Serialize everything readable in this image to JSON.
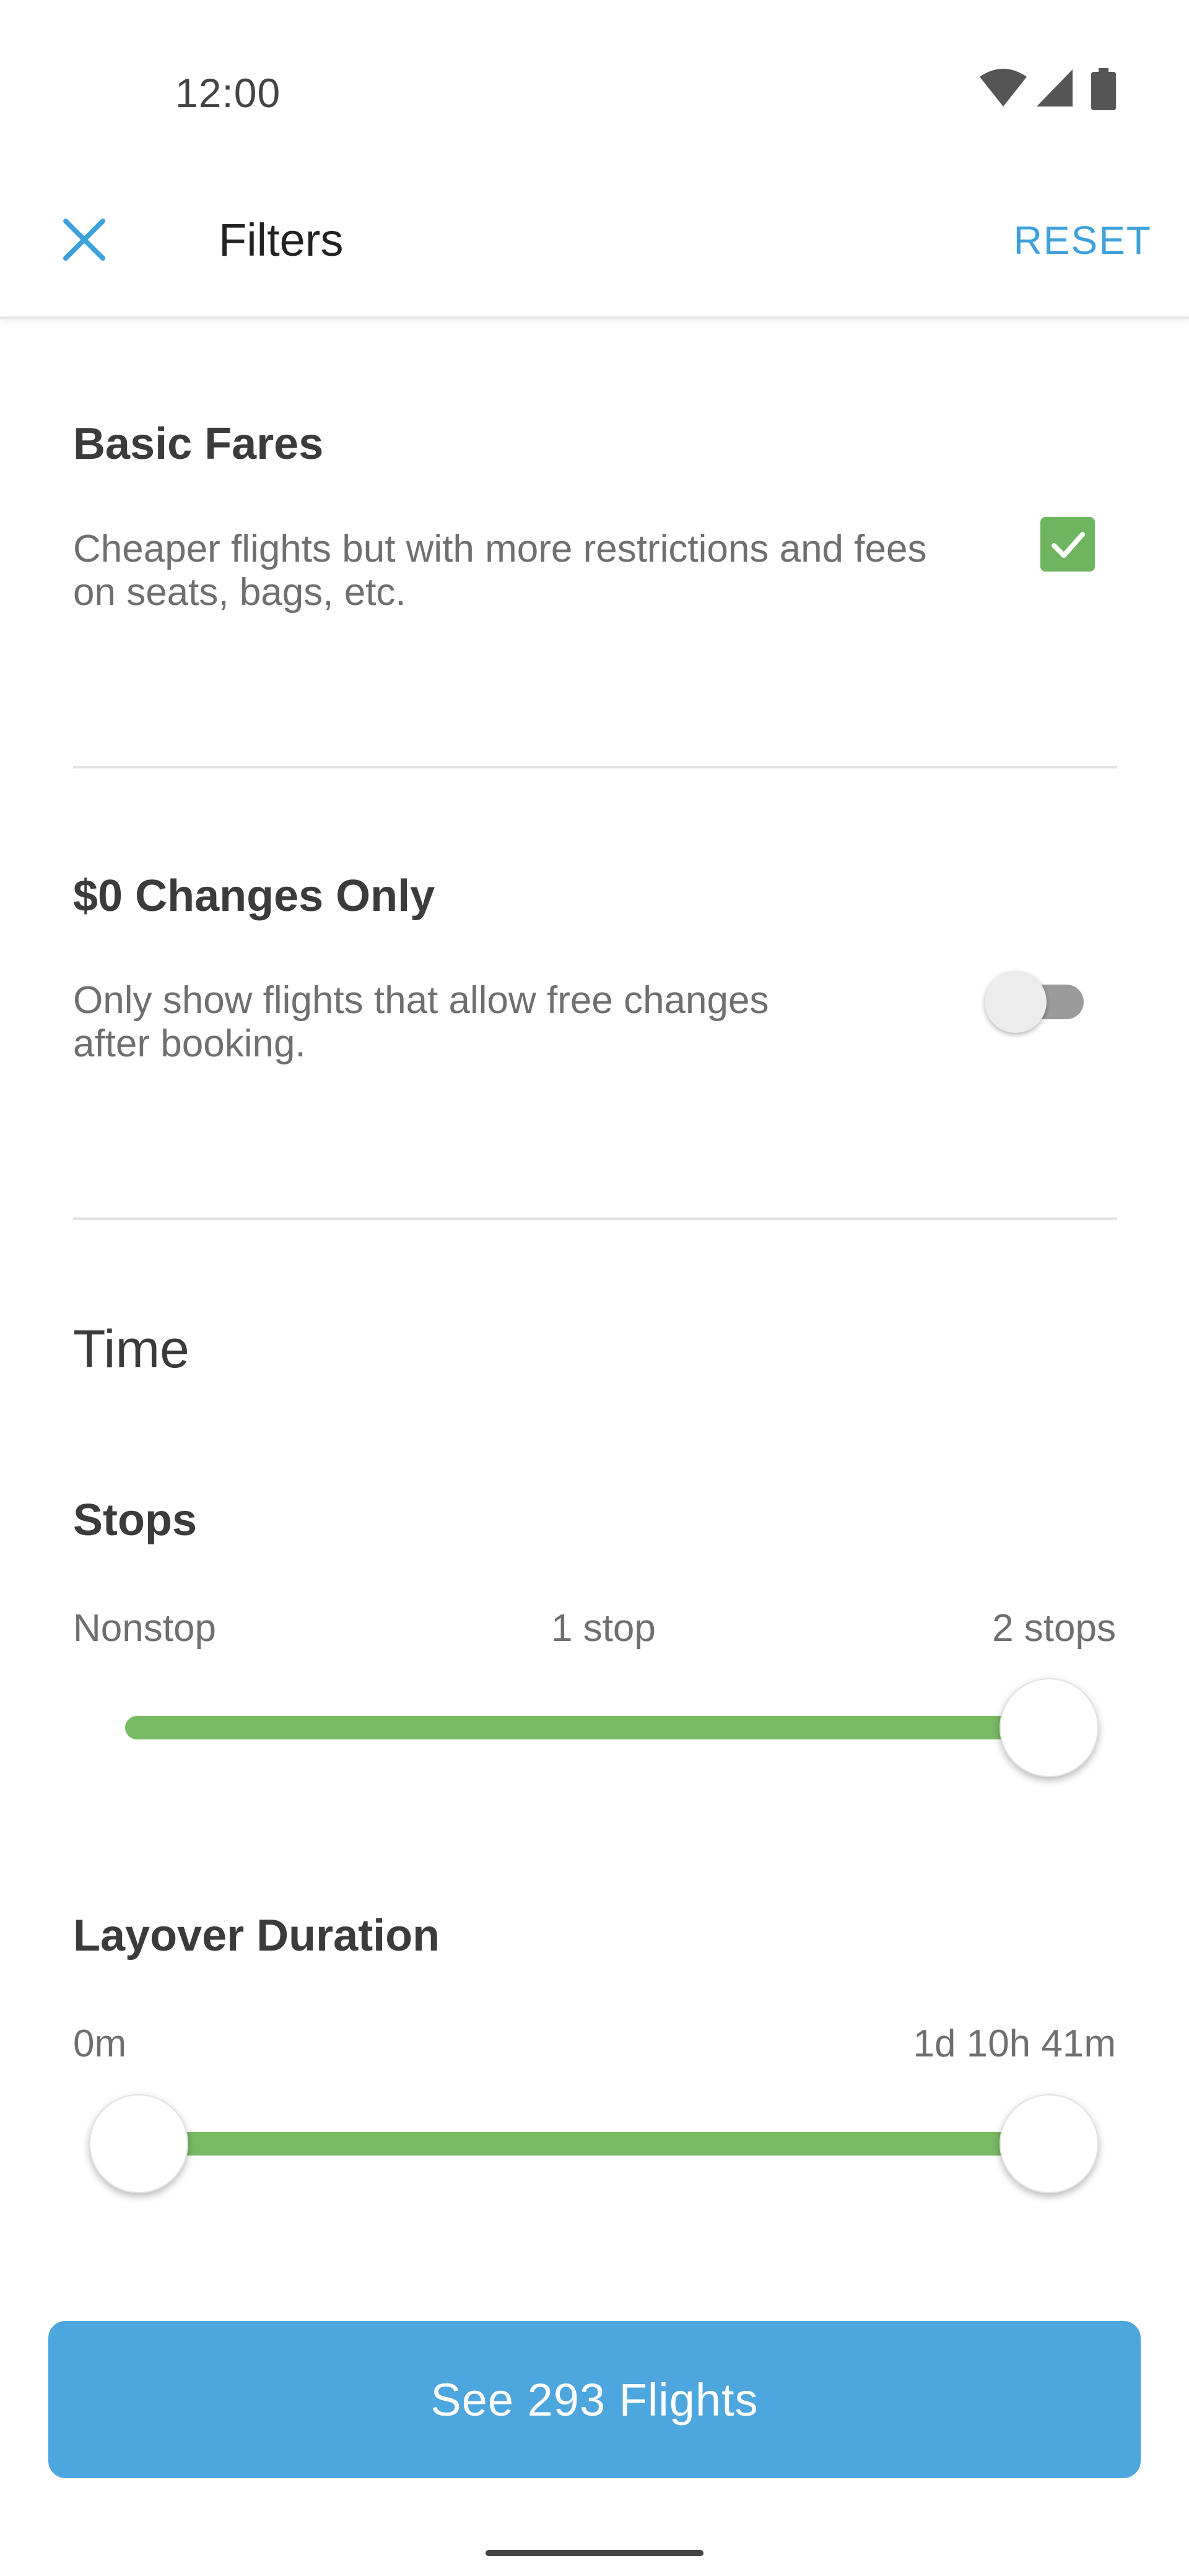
{
  "status_bar": {
    "time": "12:00",
    "icons": [
      "wifi-icon",
      "signal-icon",
      "battery-icon"
    ]
  },
  "app_bar": {
    "close_icon": "close-icon",
    "title": "Filters",
    "reset_label": "RESET"
  },
  "basic_fares": {
    "title": "Basic Fares",
    "description_line1": "Cheaper flights but with more restrictions and fees",
    "description_line2": "on seats, bags, etc.",
    "checked": true
  },
  "zero_changes": {
    "title": "$0 Changes Only",
    "description_line1": "Only show flights that allow free changes",
    "description_line2": "after booking.",
    "enabled": false
  },
  "time_section": {
    "heading": "Time"
  },
  "stops": {
    "title": "Stops",
    "labels": [
      "Nonstop",
      "1 stop",
      "2 stops"
    ],
    "selected_max_index": 2
  },
  "layover": {
    "title": "Layover Duration",
    "min_label": "0m",
    "max_label": "1d 10h 41m",
    "range_fraction": [
      0,
      1
    ]
  },
  "cta": {
    "label": "See 293 Flights"
  },
  "colors": {
    "accent_blue": "#4da6dd",
    "reset_blue": "#3ea0dd",
    "green": "#78ba65",
    "checkbox_green": "#6fb55f"
  }
}
